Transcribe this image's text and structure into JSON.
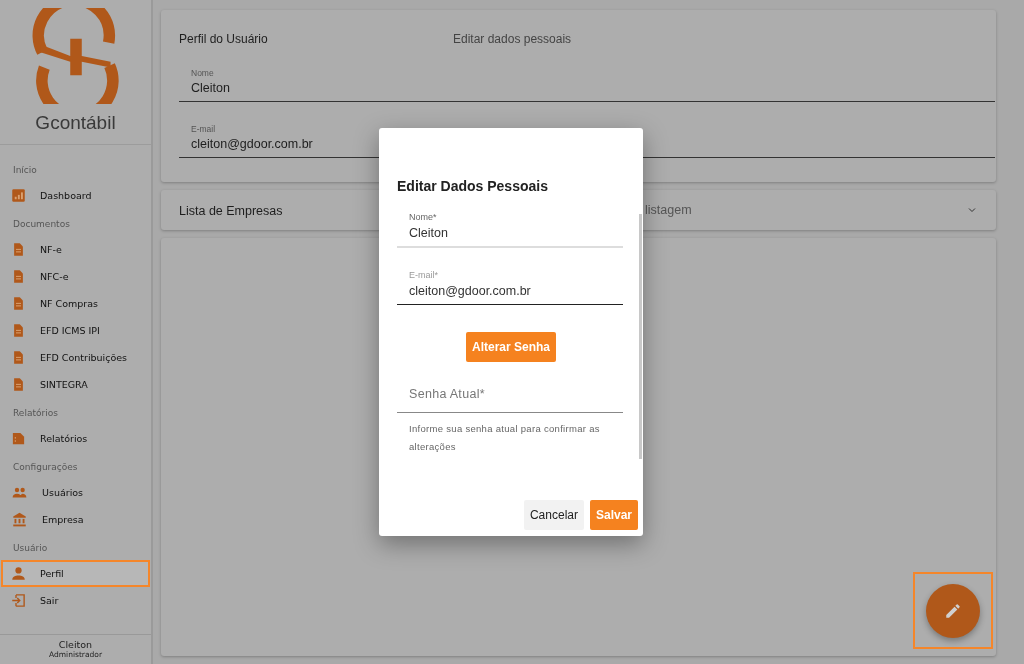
{
  "sidebar": {
    "logo_text": "Gcontábil",
    "sections": [
      {
        "title": "Início",
        "items": [
          {
            "label": "Dashboard",
            "kind": "chart",
            "selected": false
          }
        ]
      },
      {
        "title": "Documentos",
        "items": [
          {
            "label": "NF-e",
            "kind": "document",
            "selected": false
          },
          {
            "label": "NFC-e",
            "kind": "document",
            "selected": false
          },
          {
            "label": "NF Compras",
            "kind": "document",
            "selected": false
          },
          {
            "label": "EFD ICMS IPI",
            "kind": "document",
            "selected": false
          },
          {
            "label": "EFD Contribuições",
            "kind": "document",
            "selected": false
          },
          {
            "label": "SINTEGRA",
            "kind": "document",
            "selected": false
          }
        ]
      },
      {
        "title": "Relatórios",
        "items": [
          {
            "label": "Relatórios",
            "kind": "report",
            "selected": false
          }
        ]
      },
      {
        "title": "Configurações",
        "items": [
          {
            "label": "Usuários",
            "kind": "users",
            "selected": false
          },
          {
            "label": "Empresa",
            "kind": "bank",
            "selected": false
          }
        ]
      },
      {
        "title": "Usuário",
        "items": [
          {
            "label": "Perfil",
            "kind": "person",
            "selected": true
          },
          {
            "label": "Sair",
            "kind": "exit",
            "selected": false
          }
        ]
      }
    ],
    "user": {
      "name": "Cleiton",
      "role": "Administrador"
    }
  },
  "profile_card": {
    "tabs": [
      {
        "label": "Perfil do Usuário",
        "selected": true
      },
      {
        "label": "Editar dados pessoais",
        "selected": false
      }
    ],
    "fields": [
      {
        "label": "Nome",
        "value": "Cleiton"
      },
      {
        "label": "E-mail",
        "value": "cleiton@gdoor.com.br"
      }
    ]
  },
  "companies_panel": {
    "title": "Lista de Empresas",
    "hint": "listagem",
    "expanded": false
  },
  "dialog": {
    "title": "Editar Dados Pessoais",
    "fields": [
      {
        "label": "Nome*",
        "value": "Cleiton",
        "focused": false
      },
      {
        "label": "E-mail*",
        "value": "cleiton@gdoor.com.br",
        "focused": true
      }
    ],
    "change_password_button": "Alterar Senha",
    "password_field": {
      "placeholder": "Senha Atual*",
      "helper": "Informe sua senha atual para confirmar as alterações"
    },
    "buttons": [
      {
        "label": "Cancelar",
        "kind": "secondary"
      },
      {
        "label": "Salvar",
        "kind": "primary"
      }
    ]
  },
  "fab": {
    "highlighted": true
  }
}
